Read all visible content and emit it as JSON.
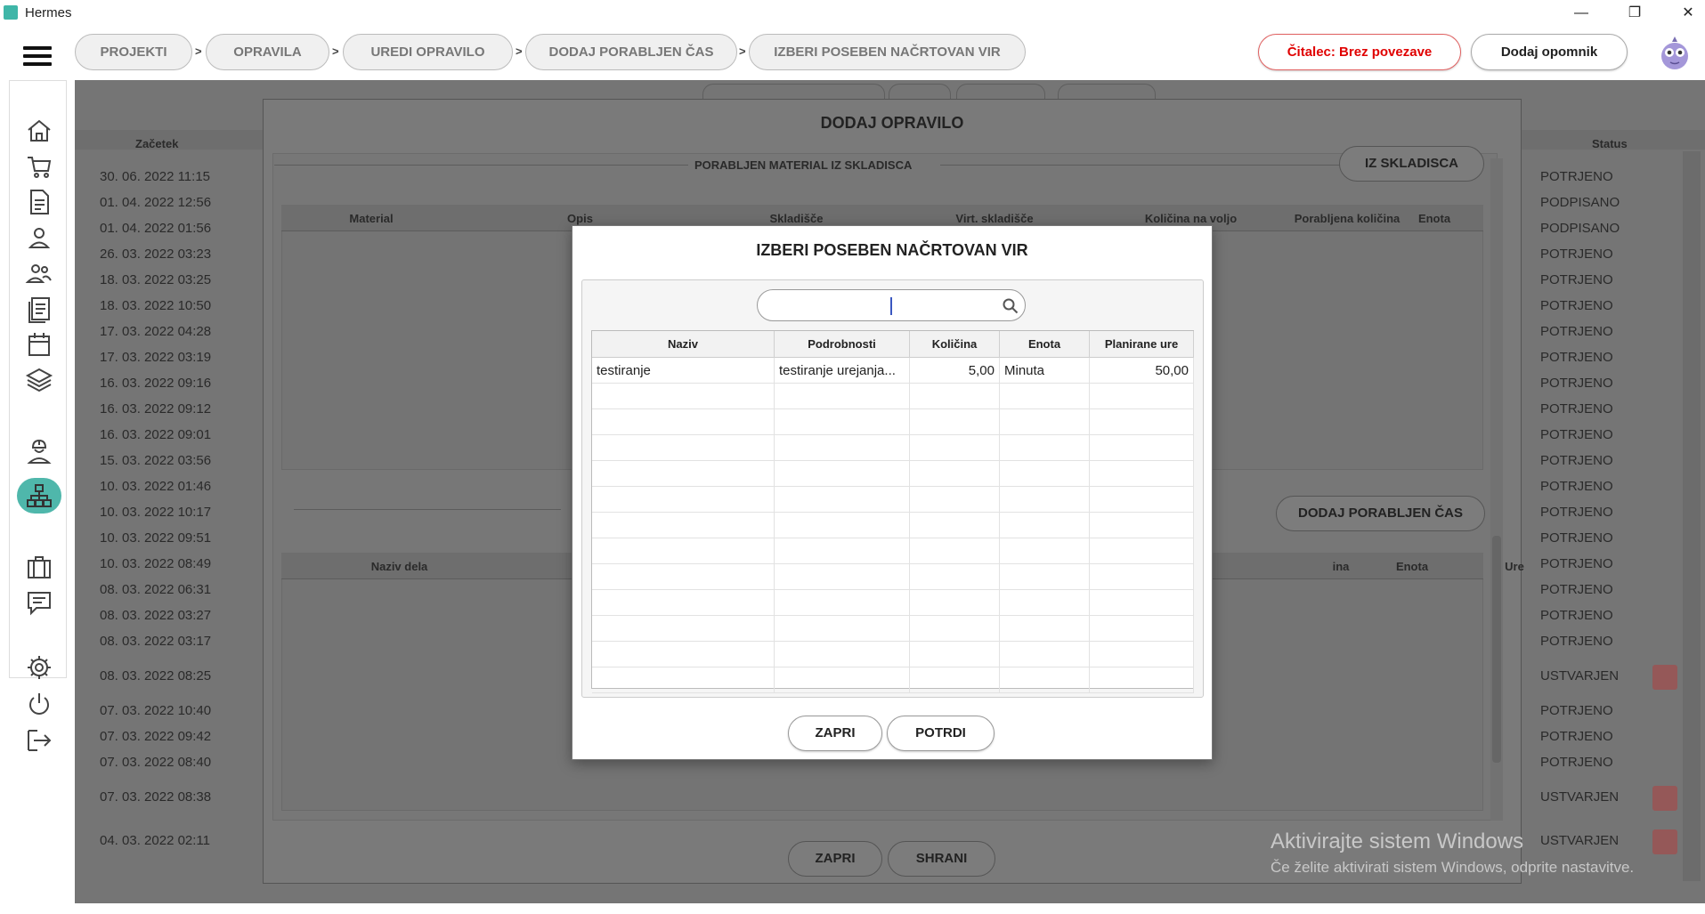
{
  "window": {
    "title": "Hermes",
    "controls": [
      "—",
      "❐",
      "✕"
    ]
  },
  "breadcrumb": [
    {
      "label": "PROJEKTI"
    },
    {
      "label": "OPRAVILA"
    },
    {
      "label": "UREDI OPRAVILO"
    },
    {
      "label": "DODAJ PORABLJEN ČAS"
    },
    {
      "label": "IZBERI POSEBEN NAČRTOVAN VIR"
    }
  ],
  "breadcrumb_separator": ">",
  "header": {
    "reader_status": "Čitalec: Brez povezave",
    "add_reminder": "Dodaj opomnik"
  },
  "sidebar": {
    "icons": [
      "home-icon",
      "cart-icon",
      "document-icon",
      "user-icon",
      "users-icon",
      "list-icon",
      "calendar-icon",
      "layers-icon",
      "hierarchy-icon",
      "worker-icon",
      "briefcase-icon",
      "chat-icon",
      "settings-icon",
      "power-icon",
      "logout-icon"
    ],
    "active": "hierarchy-icon"
  },
  "background_table": {
    "col_start": "Začetek",
    "col_status": "Status",
    "rows": [
      {
        "start": "30. 06. 2022 11:15",
        "status": "POTRJENO"
      },
      {
        "start": "01. 04. 2022 12:56",
        "status": "PODPISANO"
      },
      {
        "start": "01. 04. 2022 01:56",
        "status": "PODPISANO"
      },
      {
        "start": "26. 03. 2022 03:23",
        "status": "POTRJENO"
      },
      {
        "start": "18. 03. 2022 03:25",
        "status": "POTRJENO"
      },
      {
        "start": "18. 03. 2022 10:50",
        "status": "POTRJENO"
      },
      {
        "start": "17. 03. 2022 04:28",
        "status": "POTRJENO"
      },
      {
        "start": "17. 03. 2022 03:19",
        "status": "POTRJENO"
      },
      {
        "start": "16. 03. 2022 09:16",
        "status": "POTRJENO"
      },
      {
        "start": "16. 03. 2022 09:12",
        "status": "POTRJENO"
      },
      {
        "start": "16. 03. 2022 09:01",
        "status": "POTRJENO"
      },
      {
        "start": "15. 03. 2022 03:56",
        "status": "POTRJENO"
      },
      {
        "start": "10. 03. 2022 01:46",
        "status": "POTRJENO"
      },
      {
        "start": "10. 03. 2022 10:17",
        "status": "POTRJENO"
      },
      {
        "start": "10. 03. 2022 09:51",
        "status": "POTRJENO"
      },
      {
        "start": "10. 03. 2022 08:49",
        "status": "POTRJENO"
      },
      {
        "start": "08. 03. 2022 06:31",
        "status": "POTRJENO"
      },
      {
        "start": "08. 03. 2022 03:27",
        "status": "POTRJENO"
      },
      {
        "start": "08. 03. 2022 03:17",
        "status": "POTRJENO"
      },
      {
        "start": "08. 03. 2022 08:25",
        "status": "USTVARJEN"
      },
      {
        "start": "07. 03. 2022 10:40",
        "status": "POTRJENO"
      },
      {
        "start": "07. 03. 2022 09:42",
        "status": "POTRJENO"
      },
      {
        "start": "07. 03. 2022 08:40",
        "status": "POTRJENO"
      },
      {
        "start": "07. 03. 2022 08:38",
        "status": "USTVARJEN"
      },
      {
        "start": "04. 03. 2022 02:11",
        "status": "USTVARJEN"
      }
    ]
  },
  "parent_dialog": {
    "title": "DODAJ OPRAVILO",
    "material_section_title": "PORABLJEN MATERIAL IZ SKLADISCA",
    "from_storage_button": "IZ SKLADISCA",
    "material_columns": [
      "Material",
      "Opis",
      "Skladišče",
      "Virt. skladišče",
      "Količina na voljo",
      "Porabljena količina",
      "Enota"
    ],
    "add_time_button": "DODAJ PORABLJEN ČAS",
    "work_columns": [
      "Naziv dela",
      "ina",
      "Enota",
      "Ure"
    ],
    "close_button": "ZAPRI",
    "save_button": "SHRANI"
  },
  "modal": {
    "title": "IZBERI POSEBEN NAČRTOVAN VIR",
    "search": {
      "value": "",
      "placeholder": ""
    },
    "columns": [
      "Naziv",
      "Podrobnosti",
      "Količina",
      "Enota",
      "Planirane ure"
    ],
    "rows": [
      {
        "naziv": "testiranje",
        "podrobnosti": "testiranje urejanja...",
        "kolicina": "5,00",
        "enota": "Minuta",
        "ure": "50,00"
      }
    ],
    "close_button": "ZAPRI",
    "confirm_button": "POTRDI"
  },
  "watermark": {
    "line1": "Aktivirajte sistem Windows",
    "line2": "Če želite aktivirati sistem Windows, odprite nastavitve."
  }
}
